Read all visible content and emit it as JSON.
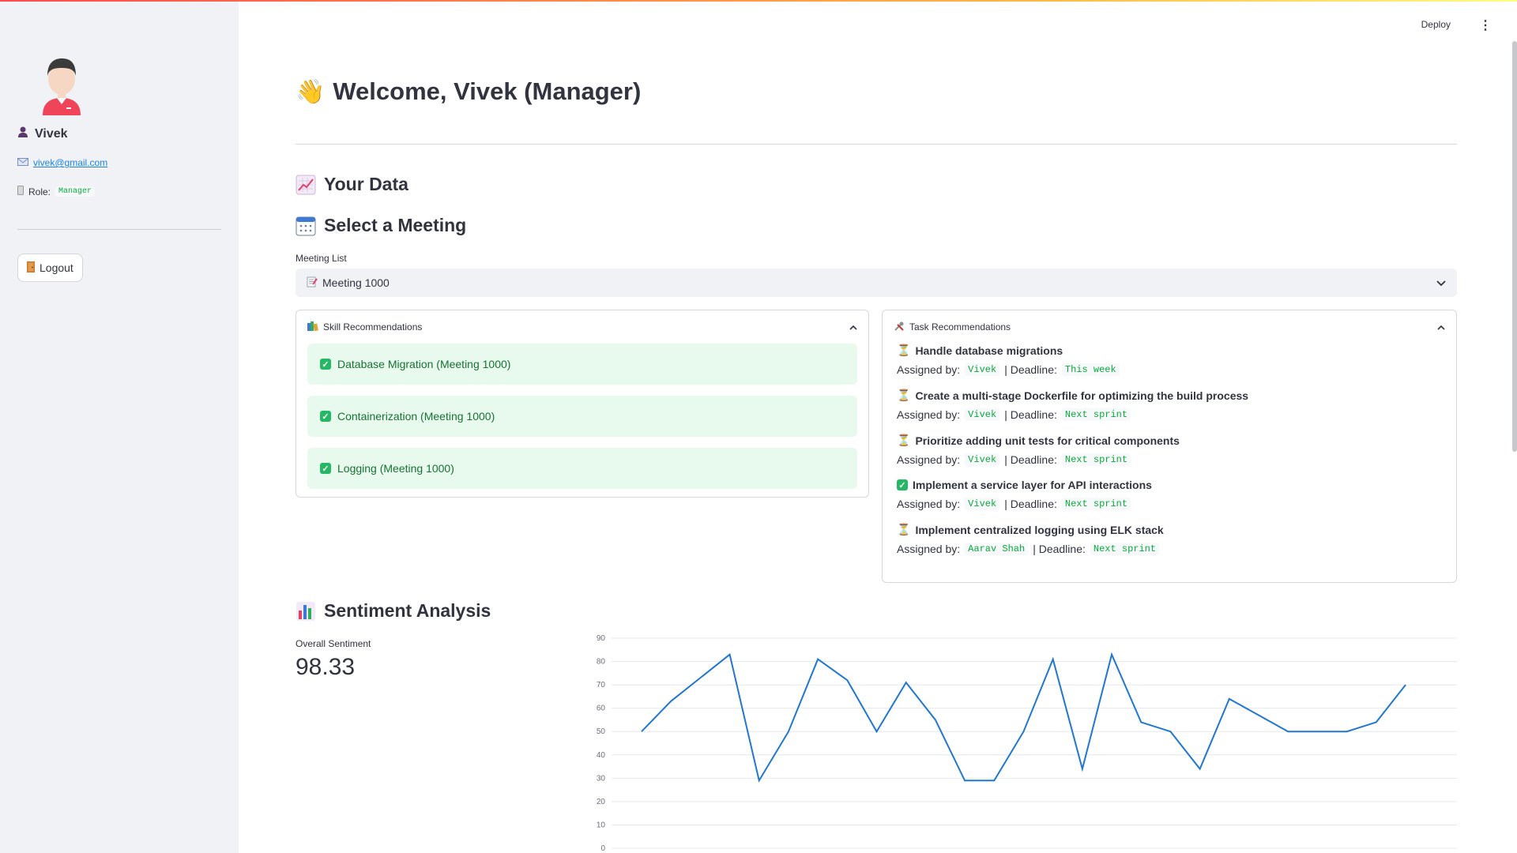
{
  "header": {
    "deploy_label": "Deploy",
    "menu_icon": "kebab-menu-icon"
  },
  "sidebar": {
    "avatar_icon": "user-avatar-icon",
    "name": "Vivek",
    "name_icon": "person-icon",
    "email": "vivek@gmail.com",
    "email_icon": "envelope-icon",
    "role_label": "Role:",
    "role_value": "Manager",
    "role_icon": "badge-icon",
    "logout_label": "Logout",
    "logout_icon": "door-icon"
  },
  "main": {
    "title": "Welcome, Vivek (Manager)",
    "title_icon": "waving-hand-icon",
    "your_data_heading": "Your Data",
    "select_meeting_heading": "Select a Meeting",
    "meeting_list_label": "Meeting List",
    "meeting_selected": "Meeting 1000",
    "skill_rec": {
      "title": "Skill Recommendations",
      "items": [
        "Database Migration (Meeting 1000)",
        "Containerization (Meeting 1000)",
        "Logging (Meeting 1000)"
      ]
    },
    "task_rec": {
      "title": "Task Recommendations",
      "assigned_label": "Assigned by:",
      "deadline_label": "| Deadline:",
      "items": [
        {
          "status": "pending",
          "title": "Handle database migrations",
          "assigned_by": "Vivek",
          "deadline": "This week"
        },
        {
          "status": "pending",
          "title": "Create a multi-stage Dockerfile for optimizing the build process",
          "assigned_by": "Vivek",
          "deadline": "Next sprint"
        },
        {
          "status": "pending",
          "title": "Prioritize adding unit tests for critical components",
          "assigned_by": "Vivek",
          "deadline": "Next sprint"
        },
        {
          "status": "done",
          "title": "Implement a service layer for API interactions",
          "assigned_by": "Vivek",
          "deadline": "Next sprint"
        },
        {
          "status": "pending",
          "title": "Implement centralized logging using ELK stack",
          "assigned_by": "Aarav Shah",
          "deadline": "Next sprint"
        }
      ]
    },
    "sentiment_heading": "Sentiment Analysis",
    "overall_label": "Overall Sentiment",
    "overall_value": "98.33"
  },
  "colors": {
    "accent": "#ff4b4b",
    "line": "#1f77d0",
    "success_bg": "#e8f9ee",
    "success_text": "#177233",
    "code_green": "#09ab3b"
  },
  "chart_data": {
    "type": "line",
    "y_ticks": [
      0,
      10,
      20,
      30,
      40,
      50,
      60,
      70,
      80,
      90
    ],
    "ylim": [
      0,
      90
    ],
    "grid": true,
    "values": [
      50,
      63,
      73,
      83,
      29,
      50,
      81,
      72,
      50,
      71,
      55,
      29,
      29,
      50,
      81,
      34,
      83,
      54,
      50,
      34,
      64,
      57,
      50,
      50,
      50,
      54,
      70
    ]
  }
}
